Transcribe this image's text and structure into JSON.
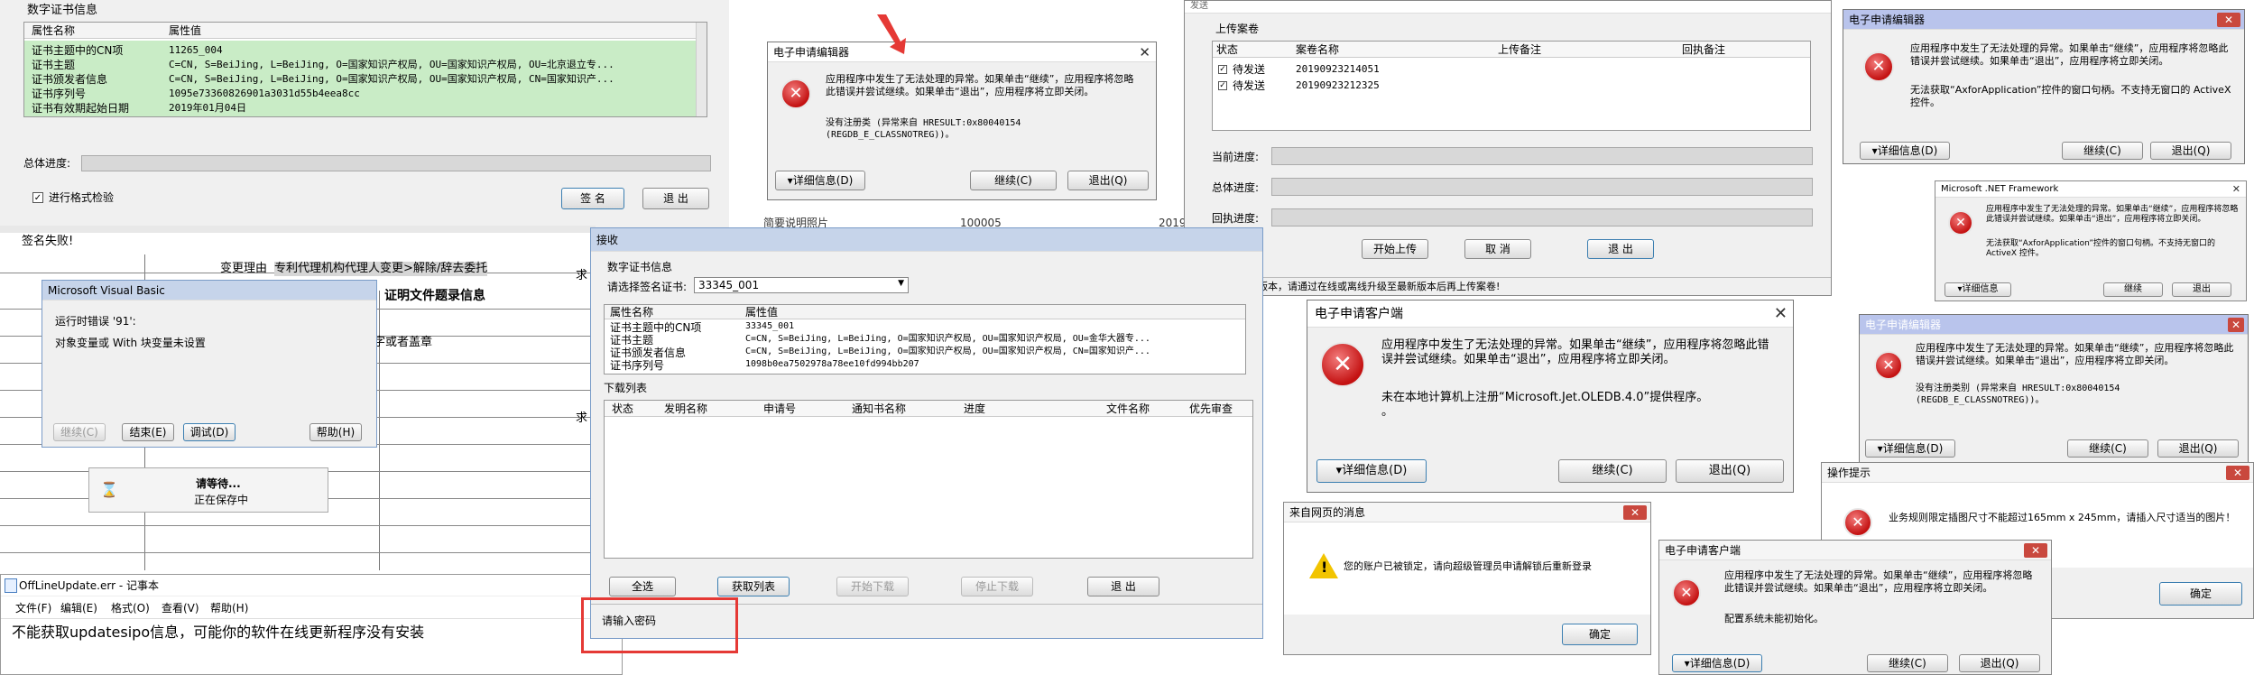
{
  "certLeft": {
    "title": "数字证书信息",
    "col_name": "属性名称",
    "col_value": "属性值",
    "rows": [
      {
        "k": "证书主题中的CN项",
        "v": "11265_004"
      },
      {
        "k": "证书主题",
        "v": "C=CN, S=BeiJing, L=BeiJing, O=国家知识产权局, OU=国家知识产权局, OU=北京退立专..."
      },
      {
        "k": "证书颁发者信息",
        "v": "C=CN, S=BeiJing, L=BeiJing, O=国家知识产权局, OU=国家知识产权局, CN=国家知识产..."
      },
      {
        "k": "证书序列号",
        "v": "1095e73360826901a3031d55b4eea8cc"
      },
      {
        "k": "证书有效期起始日期",
        "v": "2019年01月04日"
      }
    ],
    "progress_label": "总体进度:",
    "checkbox_label": "进行格式检验",
    "sign_btn": "签 名",
    "exit_btn": "退 出",
    "sign_fail": "签名失败!"
  },
  "doc": {
    "change_reason": "变更理由",
    "change_reason_value": "专利代理机构代理人变更>解除/辞去委托",
    "proof_title": "证明文件题录信息",
    "seal_text": "字或者盖章",
    "stub": "求",
    "stub2": "求"
  },
  "vb": {
    "title": "Microsoft Visual Basic",
    "line1": "运行时错误 '91':",
    "line2": "对象变量或 With 块变量未设置",
    "btn_continue": "继续(C)",
    "btn_end": "结束(E)",
    "btn_debug": "调试(D)",
    "btn_help": "帮助(H)"
  },
  "wait": {
    "line1": "请等待...",
    "line2": "正在保存中"
  },
  "notepad": {
    "title": "OffLineUpdate.err - 记事本",
    "menus": [
      "文件(F)",
      "编辑(E)",
      "格式(O)",
      "查看(V)",
      "帮助(H)"
    ],
    "content": "不能获取updatesipo信息，可能你的软件在线更新程序没有安装"
  },
  "err1": {
    "title": "电子申请编辑器",
    "message": "应用程序中发生了无法处理的异常。如果单击“继续”，应用程序将忽略此错误并尝试继续。如果单击“退出”，应用程序将立即关闭。",
    "detail": "没有注册类 (异常来自 HRESULT:0x80040154\n(REGDB_E_CLASSNOTREG))。",
    "btn_details": "▾详细信息(D)",
    "btn_continue": "继续(C)",
    "btn_exit": "退出(Q)"
  },
  "bgtable": {
    "c1": "简要说明照片",
    "c2": "100005",
    "c3": "2019"
  },
  "upload": {
    "title": "发送",
    "frame_label": "上传案卷",
    "cols": [
      "状态",
      "案卷名称",
      "上传备注",
      "回执备注"
    ],
    "rows": [
      {
        "status": "待发送",
        "name": "20190923214051"
      },
      {
        "status": "待发送",
        "name": "20190923212325"
      }
    ],
    "lbl_current": "当前进度:",
    "lbl_total": "总体进度:",
    "lbl_receipt": "回执进度:",
    "btn_start": "开始上传",
    "btn_cancel": "取 消",
    "btn_exit": "退 出",
    "status_bar": "客户端不是最新版本，请通过在线或离线升级至最新版本后再上传案卷!"
  },
  "receive": {
    "title": "接收",
    "group_title": "数字证书信息",
    "select_label": "请选择签名证书:",
    "select_value": "33345_001",
    "col_name": "属性名称",
    "col_value": "属性值",
    "rows": [
      {
        "k": "证书主题中的CN项",
        "v": "33345_001"
      },
      {
        "k": "证书主题",
        "v": "C=CN, S=BeiJing, L=BeiJing, O=国家知识产权局, OU=国家知识产权局, OU=金华大器专..."
      },
      {
        "k": "证书颁发者信息",
        "v": "C=CN, S=BeiJing, L=BeiJing, O=国家知识产权局, OU=国家知识产权局, CN=国家知识产..."
      },
      {
        "k": "证书序列号",
        "v": "1098b0ea7502978a78ee10fd994bb207"
      }
    ],
    "download_list": "下载列表",
    "dl_cols": [
      "状态",
      "发明名称",
      "申请号",
      "通知书名称",
      "进度",
      "文件名称",
      "优先审查"
    ],
    "btn_all": "全选",
    "btn_get": "获取列表",
    "btn_start": "开始下载",
    "btn_stop": "停止下载",
    "btn_exit": "退 出",
    "status": "请输入密码"
  },
  "client1": {
    "title": "电子申请客户端",
    "message": "应用程序中发生了无法处理的异常。如果单击“继续”，应用程序将忽略此错误并尝试继续。如果单击“退出”，应用程序将立即关闭。",
    "detail": "未在本地计算机上注册“Microsoft.Jet.OLEDB.4.0”提供程序。\n。",
    "btn_details": "▾详细信息(D)",
    "btn_continue": "继续(C)",
    "btn_exit": "退出(Q)"
  },
  "web": {
    "title": "来自网页的消息",
    "message": "您的账户已被锁定，请向超级管理员申请解锁后重新登录",
    "btn_ok": "确定"
  },
  "err2": {
    "title": "电子申请编辑器",
    "message": "应用程序中发生了无法处理的异常。如果单击“继续”，应用程序将忽略此错误并尝试继续。如果单击“退出”，应用程序将立即关闭。",
    "detail": "无法获取“AxforApplication”控件的窗口句柄。不支持无窗口的 ActiveX 控件。",
    "btn_details": "▾详细信息(D)",
    "btn_continue": "继续(C)",
    "btn_exit": "退出(Q)"
  },
  "netfw": {
    "title": "Microsoft .NET Framework",
    "message": "应用程序中发生了无法处理的异常。如果单击“继续”，应用程序将忽略此错误并尝试继续。如果单击“退出”，应用程序将立即关闭。",
    "detail": "无法获取“AxforApplication”控件的窗口句柄。不支持无窗口的 ActiveX 控件。",
    "btn_details": "▾详细信息",
    "btn_continue": "继续",
    "btn_exit": "退出"
  },
  "err3": {
    "title": "电子申请编辑器",
    "message": "应用程序中发生了无法处理的异常。如果单击“继续”，应用程序将忽略此错误并尝试继续。如果单击“退出”，应用程序将立即关闭。",
    "detail": "没有注册类别 (异常来自 HRESULT:0x80040154\n(REGDB_E_CLASSNOTREG))。",
    "btn_details": "▾详细信息(D)",
    "btn_continue": "继续(C)",
    "btn_exit": "退出(Q)"
  },
  "prompt": {
    "title": "操作提示",
    "message": "业务规则限定插图尺寸不能超过165mm x 245mm，请插入尺寸适当的图片！",
    "btn_ok": "确定"
  },
  "client2": {
    "title": "电子申请客户端",
    "message": "应用程序中发生了无法处理的异常。如果单击“继续”，应用程序将忽略此错误并尝试继续。如果单击“退出”，应用程序将立即关闭。",
    "detail": "配置系统未能初始化。",
    "btn_details": "▾详细信息(D)",
    "btn_continue": "继续(C)",
    "btn_exit": "退出(Q)"
  },
  "colors": {
    "highlight_green": "#c9ecc6",
    "annotation_red": "#e53935",
    "error_red": "#c41212"
  }
}
